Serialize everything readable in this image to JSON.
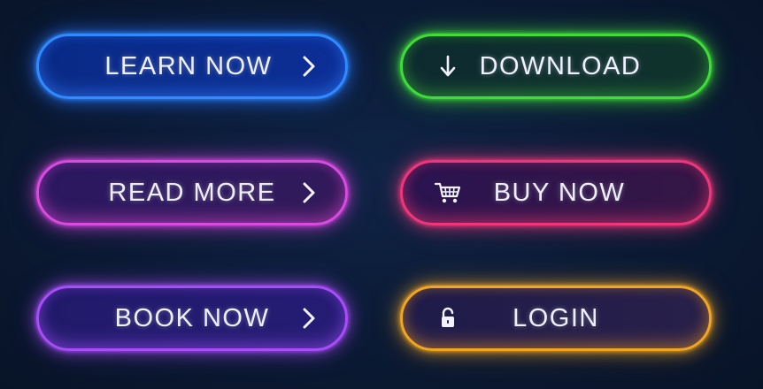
{
  "buttons": {
    "learn_now": {
      "label": "LEARN NOW",
      "icon": "chevron-right-icon",
      "color": "#2f8bff"
    },
    "download": {
      "label": "DOWNLOAD",
      "icon": "arrow-down-icon",
      "color": "#3fdc3a"
    },
    "read_more": {
      "label": "READ MORE",
      "icon": "chevron-right-icon",
      "color": "#d84ae0"
    },
    "buy_now": {
      "label": "BUY NOW",
      "icon": "shopping-cart-icon",
      "color": "#f0367a"
    },
    "book_now": {
      "label": "BOOK NOW",
      "icon": "chevron-right-icon",
      "color": "#a84cf8"
    },
    "login": {
      "label": "LOGIN",
      "icon": "unlock-icon",
      "color": "#f0a623"
    }
  },
  "background_color": "#0b1a34"
}
